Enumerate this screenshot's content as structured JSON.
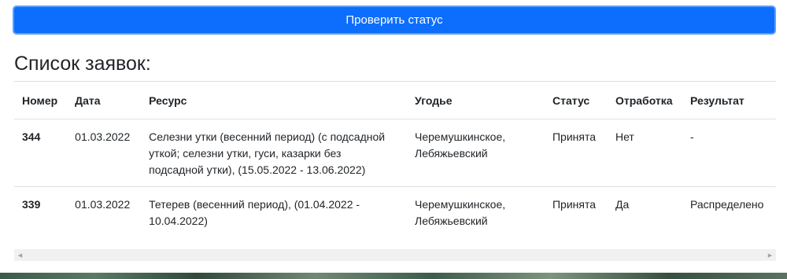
{
  "check_button": {
    "label": "Проверить статус"
  },
  "section_title": "Список заявок:",
  "table": {
    "headers": [
      "Номер",
      "Дата",
      "Ресурс",
      "Угодье",
      "Статус",
      "Отработка",
      "Результат"
    ],
    "rows": [
      {
        "number": "344",
        "date": "01.03.2022",
        "resource": "Селезни утки (весенний период) (с подсадной уткой; селезни утки, гуси, казарки без подсадной утки), (15.05.2022 - 13.06.2022)",
        "area": "Черемушкинское, Лебяжьевский",
        "status": "Принята",
        "processing": "Нет",
        "result": "-"
      },
      {
        "number": "339",
        "date": "01.03.2022",
        "resource": "Тетерев (весенний период), (01.04.2022 - 10.04.2022)",
        "area": "Черемушкинское, Лебяжьевский",
        "status": "Принята",
        "processing": "Да",
        "result": "Распределено"
      }
    ]
  },
  "icons": {
    "scroll_left": "triangle-left-icon",
    "scroll_right": "triangle-right-icon"
  },
  "colors": {
    "primary_button": "#0d6efd",
    "text": "#212529",
    "border": "#dee2e6"
  }
}
